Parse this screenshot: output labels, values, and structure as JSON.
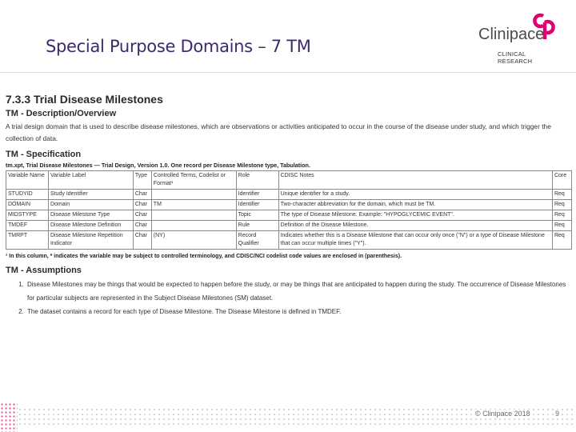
{
  "slide": {
    "title": "Special Purpose Domains – 7 TM"
  },
  "logo": {
    "name": "Clinipace",
    "tagline": "CLINICAL RESEARCH",
    "colors": {
      "brand_pink": "#e0006f",
      "text_gray": "#4b4b4b"
    }
  },
  "section": {
    "heading": "7.3.3 Trial Disease Milestones",
    "desc_heading": "TM - Description/Overview",
    "desc_text": "A trial design domain that is used to describe disease milestones, which are observations or activities anticipated to occur in the course of the disease under study, and which trigger the collection of data.",
    "spec_heading": "TM - Specification",
    "table_caption": "tm.xpt, Trial Disease Milestones — Trial Design, Version 1.0. One record per Disease Milestone type, Tabulation.",
    "columns": [
      "Variable Name",
      "Variable Label",
      "Type",
      "Controlled Terms, Codelist or Format¹",
      "Role",
      "CDISC Notes",
      "Core"
    ],
    "rows": [
      [
        "STUDYID",
        "Study Identifier",
        "Char",
        "",
        "Identifier",
        "Unique identifier for a study.",
        "Req"
      ],
      [
        "DOMAIN",
        "Domain",
        "Char",
        "TM",
        "Identifier",
        "Two-character abbreviation for the domain, which must be TM.",
        "Req"
      ],
      [
        "MIDSTYPE",
        "Disease Milestone Type",
        "Char",
        "",
        "Topic",
        "The type of Disease Milestone. Example: \"HYPOGLYCEMIC EVENT\".",
        "Req"
      ],
      [
        "TMDEF",
        "Disease Milestone Definition",
        "Char",
        "",
        "Rule",
        "Definition of the Disease Milestone.",
        "Req"
      ],
      [
        "TMRPT",
        "Disease Milestone Repetition Indicator",
        "Char",
        "(NY)",
        "Record Qualifier",
        "Indicates whether this is a Disease Milestone that can occur only once (\"N\") or a type of Disease Milestone that can occur multiple times (\"Y\").",
        "Req"
      ]
    ],
    "footnote": "¹ In this column, * indicates the variable may be subject to controlled terminology, and CDISC/NCI codelist code values are enclosed in (parenthesis).",
    "assumptions_heading": "TM - Assumptions",
    "assumptions": [
      "Disease Milestones may be things that would be expected to happen before the study, or may be things that are anticipated to happen during the study. The occurrence of Disease Milestones for particular subjects are represented in the Subject Disease Milestones (SM) dataset.",
      "The dataset contains a record for each type of Disease Milestone. The Disease Milestone is defined in TMDEF."
    ]
  },
  "footer": {
    "copyright": "© Clinipace 2018",
    "page_number": "9"
  }
}
